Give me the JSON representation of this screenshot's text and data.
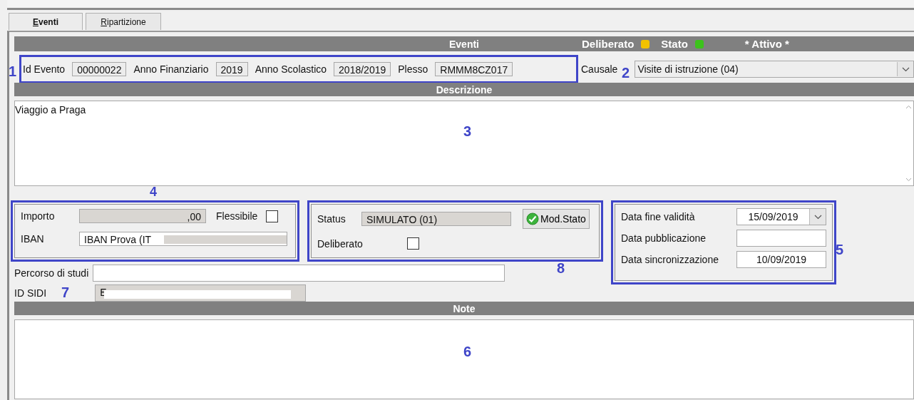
{
  "tabs": [
    {
      "label": "Eventi",
      "selected": true
    },
    {
      "label": "Ripartizione",
      "selected": false
    }
  ],
  "header": {
    "title": "Eventi",
    "indicators": [
      {
        "label": "Deliberato",
        "color": "#f2c200"
      },
      {
        "label": "Stato",
        "color": "#3cc21c"
      }
    ],
    "status": "* Attivo *"
  },
  "ident_fields": [
    {
      "label": "Id Evento",
      "value": "00000022"
    },
    {
      "label": "Anno Finanziario",
      "value": "2019"
    },
    {
      "label": "Anno Scolastico",
      "value": "2018/2019"
    },
    {
      "label": "Plesso",
      "value": "RMMM8CZ017"
    }
  ],
  "causale": {
    "label": "Causale",
    "value": "Visite di istruzione (04)"
  },
  "descrizione": {
    "title": "Descrizione",
    "value": "Viaggio a Praga"
  },
  "importo": {
    "label": "Importo",
    "value": ",00",
    "flessibile_label": "Flessibile",
    "flessibile_checked": false,
    "iban_label": "IBAN",
    "iban_value": "IBAN Prova (IT"
  },
  "stato": {
    "status_label": "Status",
    "status_value": "SIMULATO (01)",
    "button": "Mod.Stato",
    "deliberato_label": "Deliberato",
    "deliberato_checked": false
  },
  "date": [
    {
      "label": "Data fine validità",
      "value": "15/09/2019",
      "kind": "dropdown"
    },
    {
      "label": "Data pubblicazione",
      "kind": "text"
    },
    {
      "label": "Data sincronizzazione",
      "value": "10/09/2019",
      "kind": "text"
    }
  ],
  "percorso": {
    "label": "Percorso di studi"
  },
  "id_sidi": {
    "label": "ID SIDI",
    "value": "E"
  },
  "note": {
    "title": "Note"
  },
  "annotations": [
    "1",
    "2",
    "3",
    "4",
    "5",
    "6",
    "7",
    "8"
  ]
}
